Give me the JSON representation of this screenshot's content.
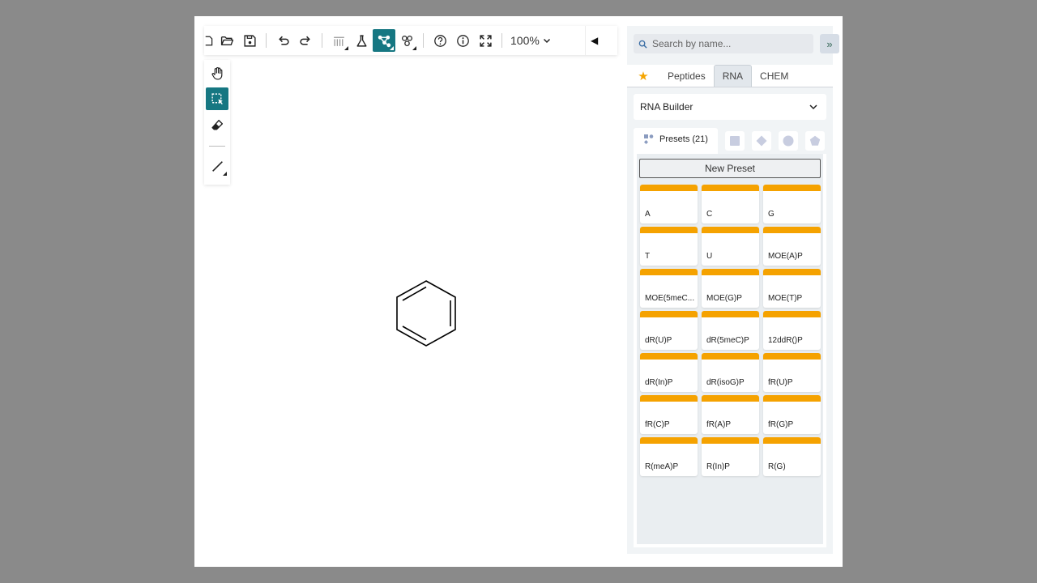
{
  "toolbar": {
    "zoom_label": "100%",
    "collapse_label": "◀"
  },
  "search": {
    "placeholder": "Search by name..."
  },
  "expand_label": "»",
  "tabs": [
    {
      "label": "★"
    },
    {
      "label": "Peptides"
    },
    {
      "label": "RNA"
    },
    {
      "label": "CHEM"
    }
  ],
  "builder": {
    "label": "RNA Builder"
  },
  "presets": {
    "tab_label": "Presets (21)",
    "new_label": "New Preset",
    "items": [
      "A",
      "C",
      "G",
      "T",
      "U",
      "MOE(A)P",
      "MOE(5meC...",
      "MOE(G)P",
      "MOE(T)P",
      "dR(U)P",
      "dR(5meC)P",
      "12ddR()P",
      "dR(In)P",
      "dR(isoG)P",
      "fR(U)P",
      "fR(C)P",
      "fR(A)P",
      "fR(G)P",
      "R(meA)P",
      "R(In)P",
      "R(G)"
    ]
  },
  "colors": {
    "accent": "#167782",
    "preset_bar": "#f5a200",
    "star": "#f5a500"
  }
}
